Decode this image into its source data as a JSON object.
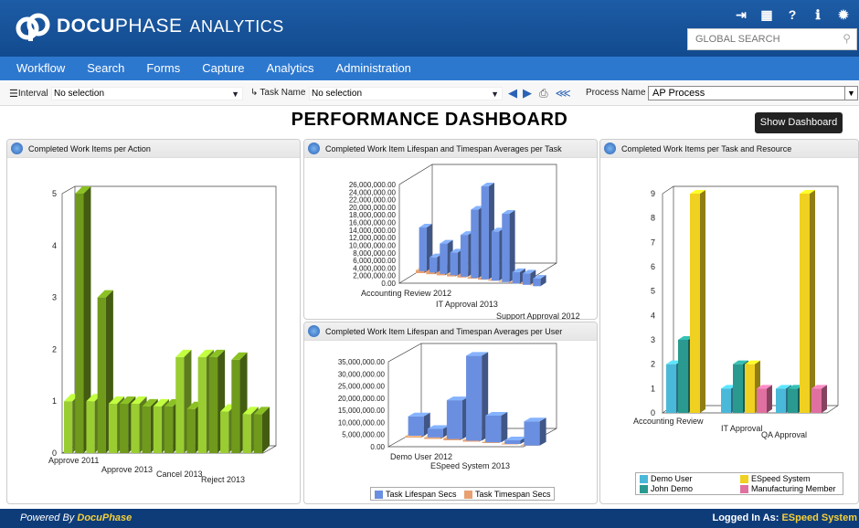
{
  "app": {
    "brand_bold": "DOCU",
    "brand_light": "PHASE",
    "brand_suffix": "ANALYTICS"
  },
  "search": {
    "placeholder": "GLOBAL SEARCH"
  },
  "header_icons": [
    "logout-icon",
    "calculator-icon",
    "help-icon",
    "info-icon",
    "settings-icon"
  ],
  "nav": [
    "Workflow",
    "Search",
    "Forms",
    "Capture",
    "Analytics",
    "Administration"
  ],
  "filters": {
    "interval_label": "Interval",
    "interval_value": "No selection",
    "task_label": "Task Name",
    "task_value": "No selection",
    "process_label": "Process Name",
    "process_value": "AP Process"
  },
  "page_title": "PERFORMANCE DASHBOARD",
  "show_dashboard": "Show Dashboard",
  "panels": {
    "p1": "Completed Work Items per Action",
    "p2": "Completed Work Item Lifespan and Timespan Averages per Task",
    "p3": "Completed Work Item Lifespan and Timespan Averages per User",
    "p4": "Completed Work Items per Task and Resource"
  },
  "legend2": {
    "lifespan": "Task Lifespan Secs",
    "timespan": "Task Timespan Secs"
  },
  "legend4": [
    "Demo User",
    "ESpeed System",
    "John Demo",
    "Manufacturing Member"
  ],
  "colors": {
    "header": "#1d5ca6",
    "nav": "#2d78cf",
    "footer": "#0e3c79",
    "green": "#9acd32",
    "blue": "#6b8fe0",
    "orange": "#e8a070",
    "cyan": "#4ab8d8",
    "yellow": "#f0d020",
    "teal": "#2a9a90",
    "pink": "#e070a0"
  },
  "footer": {
    "powered_prefix": "Powered By ",
    "powered_brand": "DocuPhase",
    "logged_prefix": "Logged In As: ",
    "logged_user": "ESpeed System"
  },
  "chart_data": [
    {
      "type": "bar",
      "title": "Completed Work Items per Action",
      "yticks": [
        "0",
        "1",
        "2",
        "3",
        "4",
        "5"
      ],
      "xlabels": [
        "Approve 2011",
        "Approve 2013",
        "Cancel 2013",
        "Reject 2013"
      ],
      "ylim": [
        0,
        5
      ],
      "values": [
        1,
        5,
        1,
        3,
        0.95,
        0.95,
        0.95,
        0.9,
        0.9,
        0.9,
        1.85,
        0.85,
        1.85,
        1.85,
        0.8,
        1.8,
        0.75,
        0.75
      ]
    },
    {
      "type": "bar",
      "title": "Completed Work Item Lifespan and Timespan Averages per Task",
      "yticks": [
        "0.00",
        "2,000,000.00",
        "4,000,000.00",
        "6,000,000.00",
        "8,000,000.00",
        "10,000,000.00",
        "12,000,000.00",
        "14,000,000.00",
        "16,000,000.00",
        "18,000,000.00",
        "20,000,000.00",
        "22,000,000.00",
        "24,000,000.00",
        "26,000,000.00"
      ],
      "xlabels": [
        "Accounting Review 2012",
        "IT Approval 2013",
        "Support Approval 2012"
      ],
      "ylim": [
        0,
        26000000
      ],
      "series": [
        {
          "name": "Task Lifespan Secs",
          "values": [
            11500000,
            4000000,
            8000000,
            6000000,
            11000000,
            18000000,
            24500000,
            13000000,
            18000000,
            3000000,
            3000000,
            2000000
          ]
        },
        {
          "name": "Task Timespan Secs",
          "values": [
            800000,
            1500000,
            2500000,
            700000,
            1200000,
            400000,
            600000,
            300000,
            200000,
            200000,
            300000,
            100000
          ]
        }
      ]
    },
    {
      "type": "bar",
      "title": "Completed Work Item Lifespan and Timespan Averages per User",
      "yticks": [
        "0.00",
        "5,000,000.00",
        "10,000,000.00",
        "15,000,000.00",
        "20,000,000.00",
        "25,000,000.00",
        "30,000,000.00",
        "35,000,000.00"
      ],
      "xlabels": [
        "Demo User 2012",
        "ESpeed System 2013"
      ],
      "ylim": [
        0,
        35000000
      ],
      "series": [
        {
          "name": "Task Lifespan Secs",
          "values": [
            8000000,
            3500000,
            16000000,
            35000000,
            11000000,
            1500000,
            10000000
          ]
        },
        {
          "name": "Task Timespan Secs",
          "values": [
            500000,
            600000,
            900000,
            800000,
            400000,
            300000,
            200000
          ]
        }
      ]
    },
    {
      "type": "bar",
      "title": "Completed Work Items per Task and Resource",
      "yticks": [
        "0",
        "1",
        "2",
        "3",
        "4",
        "5",
        "6",
        "7",
        "8",
        "9"
      ],
      "xlabels": [
        "Accounting Review",
        "IT Approval",
        "QA Approval"
      ],
      "ylim": [
        0,
        9
      ],
      "series": [
        {
          "name": "Demo User",
          "values": [
            2,
            1,
            1
          ]
        },
        {
          "name": "John Demo",
          "values": [
            3,
            2,
            1
          ]
        },
        {
          "name": "ESpeed System",
          "values": [
            9,
            2,
            9
          ]
        },
        {
          "name": "Manufacturing Member",
          "values": [
            0,
            1,
            1
          ]
        }
      ]
    }
  ]
}
